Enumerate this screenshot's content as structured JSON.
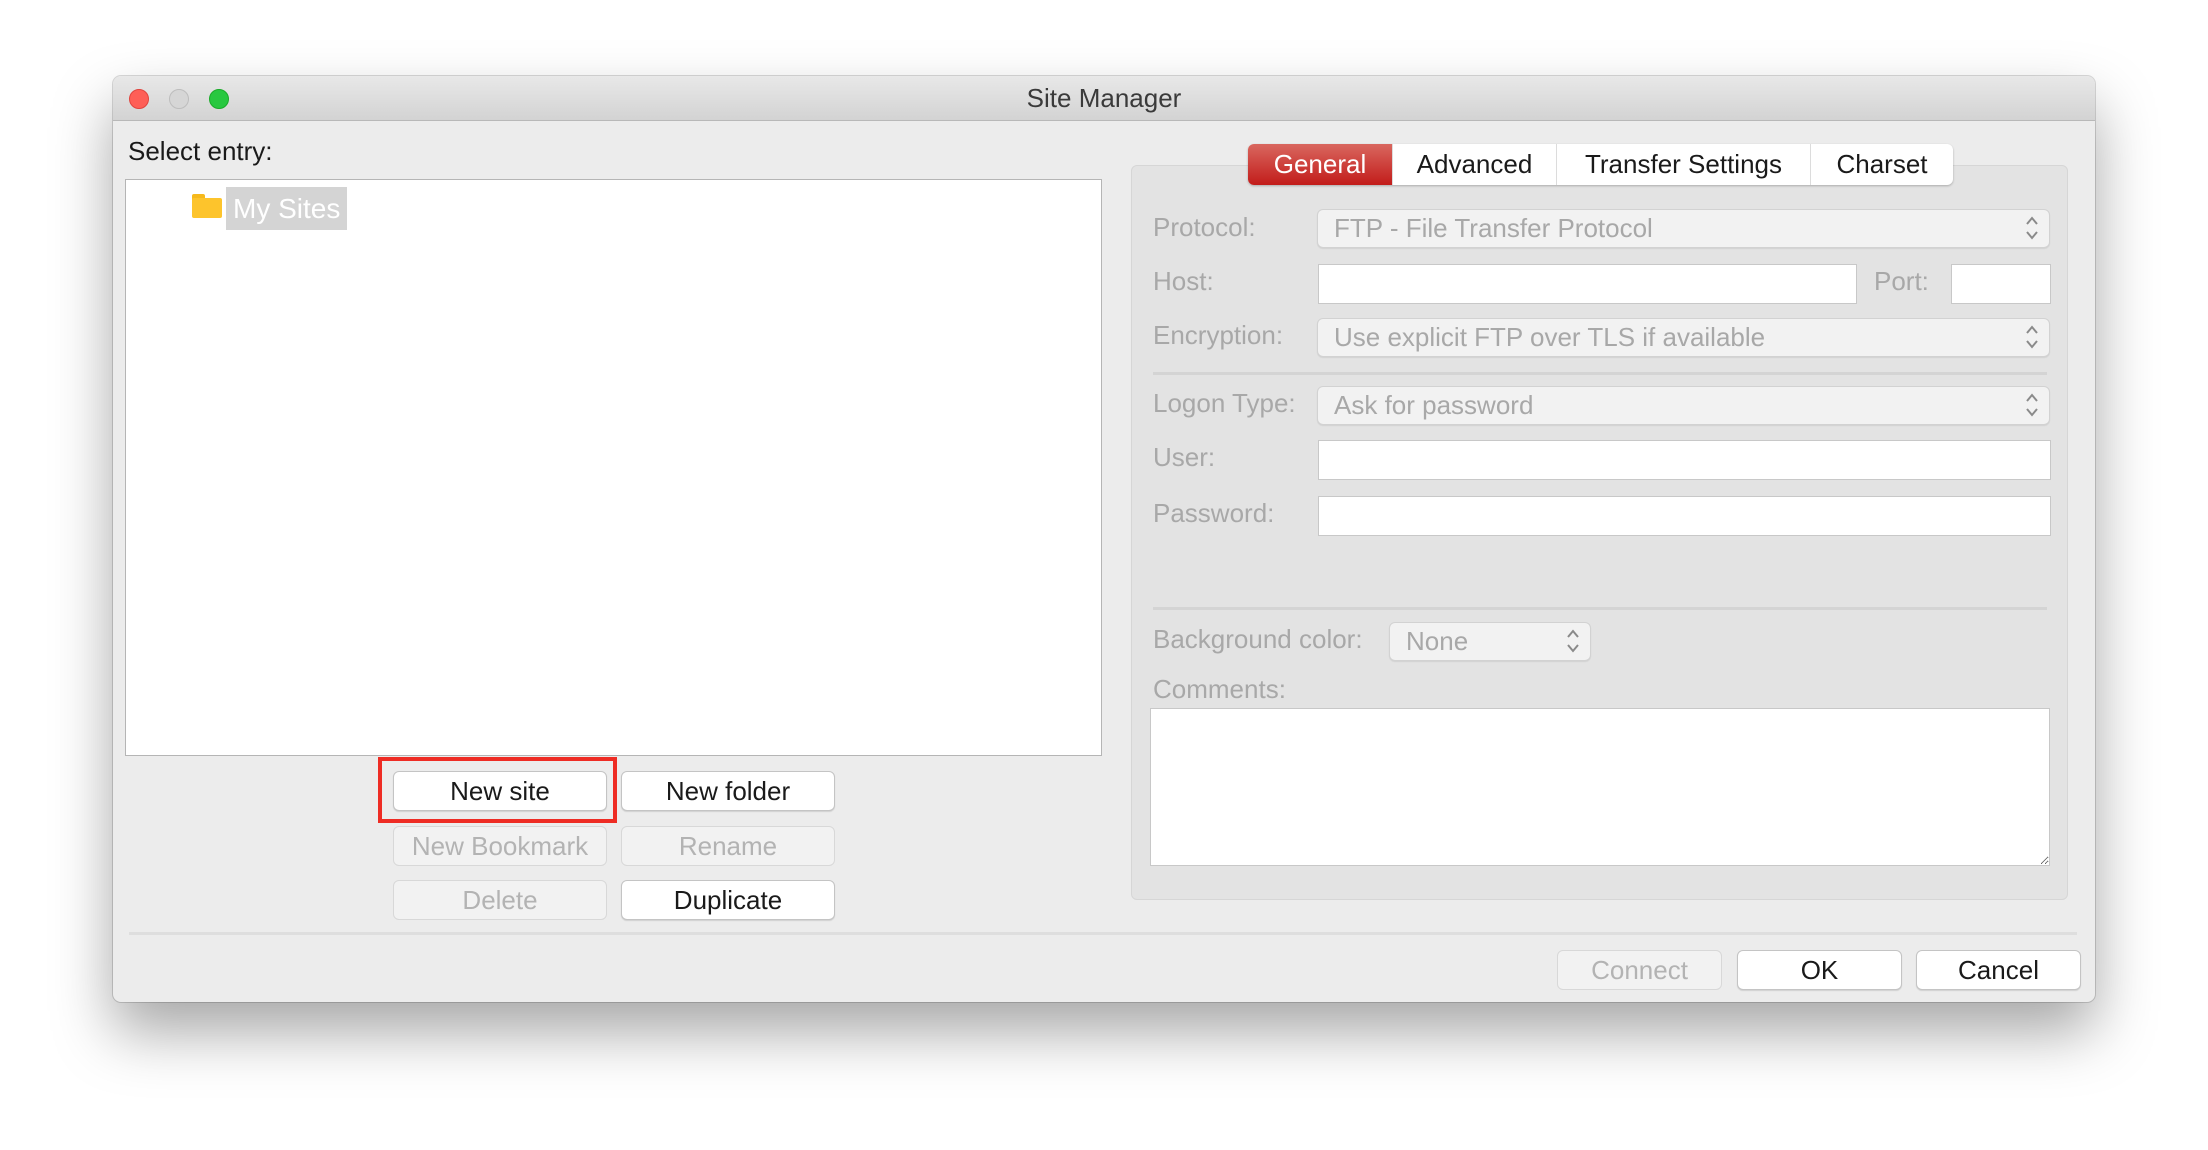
{
  "window": {
    "title": "Site Manager",
    "controls": [
      "close",
      "minimize",
      "maximize"
    ]
  },
  "left": {
    "select_entry_label": "Select entry:",
    "tree": {
      "items": [
        {
          "label": "My Sites",
          "icon": "folder-icon",
          "selected": true
        }
      ]
    },
    "buttons": {
      "new_site": "New site",
      "new_folder": "New folder",
      "new_bookmark": "New Bookmark",
      "rename": "Rename",
      "delete": "Delete",
      "duplicate": "Duplicate"
    },
    "highlighted_button": "New site"
  },
  "tabs": [
    {
      "label": "General",
      "active": true
    },
    {
      "label": "Advanced",
      "active": false
    },
    {
      "label": "Transfer Settings",
      "active": false
    },
    {
      "label": "Charset",
      "active": false
    }
  ],
  "general": {
    "protocol": {
      "label": "Protocol:",
      "value": "FTP - File Transfer Protocol"
    },
    "host": {
      "label": "Host:",
      "value": ""
    },
    "port": {
      "label": "Port:",
      "value": ""
    },
    "encryption": {
      "label": "Encryption:",
      "value": "Use explicit FTP over TLS if available"
    },
    "logon_type": {
      "label": "Logon Type:",
      "value": "Ask for password"
    },
    "user": {
      "label": "User:",
      "value": ""
    },
    "password": {
      "label": "Password:",
      "value": ""
    },
    "background_color": {
      "label": "Background color:",
      "value": "None"
    },
    "comments": {
      "label": "Comments:",
      "value": ""
    }
  },
  "footer": {
    "connect": "Connect",
    "ok": "OK",
    "cancel": "Cancel"
  },
  "colors": {
    "accent_tab": "#c21c1a",
    "highlight_box": "#ee2c24",
    "folder": "#fdc42c"
  }
}
